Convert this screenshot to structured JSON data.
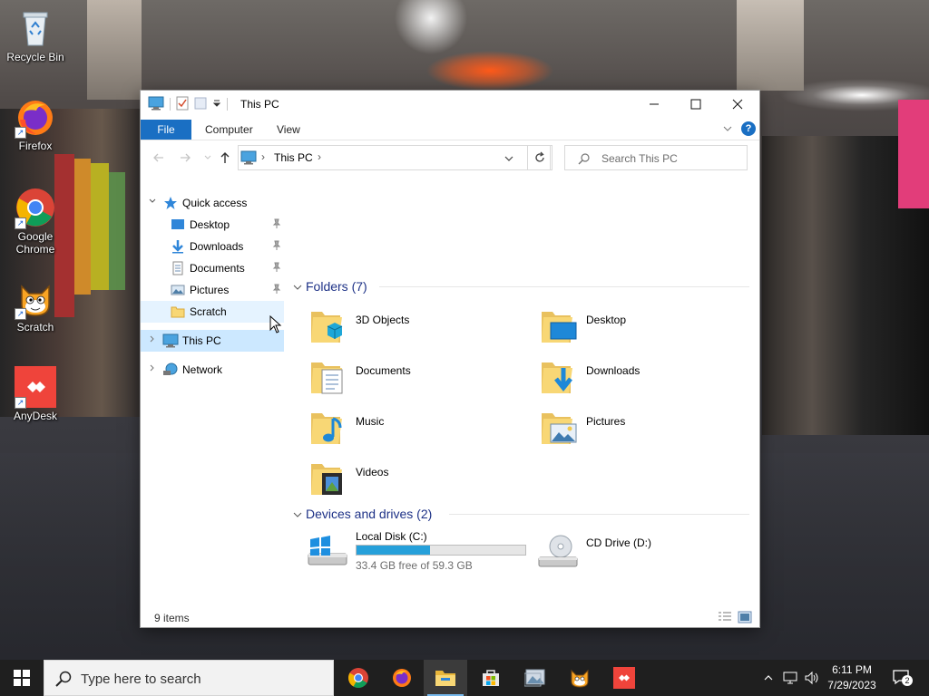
{
  "desktop": {
    "icons": [
      {
        "label": "Recycle Bin",
        "icon": "recycle-bin-icon"
      },
      {
        "label": "Firefox",
        "icon": "firefox-icon"
      },
      {
        "label": "Google Chrome",
        "icon": "chrome-icon"
      },
      {
        "label": "Scratch",
        "icon": "scratch-icon"
      },
      {
        "label": "AnyDesk",
        "icon": "anydesk-icon"
      }
    ]
  },
  "window": {
    "title": "This PC",
    "controls": {
      "minimize": "—",
      "maximize": "☐",
      "close": "✕"
    },
    "ribbon": {
      "tabs": [
        {
          "label": "File",
          "active": true
        },
        {
          "label": "Computer"
        },
        {
          "label": "View"
        }
      ],
      "help": "?"
    },
    "address": {
      "segments": [
        "This PC"
      ],
      "separator": "›"
    },
    "search": {
      "placeholder": "Search This PC"
    },
    "nav": {
      "quick_access": "Quick access",
      "quick_items": [
        {
          "label": "Desktop",
          "pinned": true
        },
        {
          "label": "Downloads",
          "pinned": true
        },
        {
          "label": "Documents",
          "pinned": true
        },
        {
          "label": "Pictures",
          "pinned": true
        },
        {
          "label": "Scratch",
          "pinned": false
        }
      ],
      "this_pc": "This PC",
      "network": "Network"
    },
    "folders": {
      "title": "Folders (7)",
      "items": [
        {
          "name": "3D Objects",
          "icon": "3d-objects-folder-icon"
        },
        {
          "name": "Desktop",
          "icon": "desktop-folder-icon"
        },
        {
          "name": "Documents",
          "icon": "documents-folder-icon"
        },
        {
          "name": "Downloads",
          "icon": "downloads-folder-icon"
        },
        {
          "name": "Music",
          "icon": "music-folder-icon"
        },
        {
          "name": "Pictures",
          "icon": "pictures-folder-icon"
        },
        {
          "name": "Videos",
          "icon": "videos-folder-icon"
        }
      ]
    },
    "drives": {
      "title": "Devices and drives (2)",
      "items": [
        {
          "name": "Local Disk (C:)",
          "free": "33.4 GB free of 59.3 GB",
          "used_fraction": 0.437,
          "icon": "local-disk-icon"
        },
        {
          "name": "CD Drive (D:)",
          "icon": "cd-drive-icon"
        }
      ]
    },
    "status": {
      "item_count": "9 items"
    }
  },
  "taskbar": {
    "search_placeholder": "Type here to search",
    "apps": [
      "Chrome",
      "Firefox",
      "File Explorer",
      "Microsoft Store",
      "Photos",
      "Scratch",
      "AnyDesk"
    ],
    "active_app": "File Explorer",
    "clock": {
      "time": "6:11 PM",
      "date": "7/29/2023"
    },
    "notification_count": "2"
  },
  "colors": {
    "accent": "#1a6fc3",
    "selection": "#cce8ff",
    "progress": "#26a0da",
    "taskbar": "#1f1f1f"
  }
}
